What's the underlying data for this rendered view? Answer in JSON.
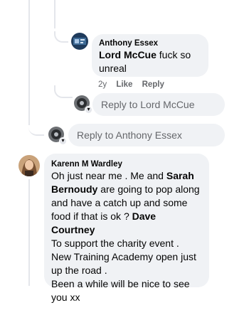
{
  "reply1": {
    "author": "Anthony Essex",
    "mention": "Lord McCue",
    "text": " fuck so unreal",
    "time": "2y",
    "like_label": "Like",
    "reply_label": "Reply"
  },
  "reply_box_inner": {
    "placeholder": "Reply to Lord McCue"
  },
  "reply_box_outer": {
    "placeholder": "Reply to Anthony Essex"
  },
  "comment2": {
    "author": "Karenn M Wardley",
    "parts": {
      "p1": "Oh just near me . Me and ",
      "m1": "Sarah Bernoudy",
      "p2": " are going to pop along and have a catch up and some food if that is ok ? ",
      "m2": "Dave Courtney",
      "line2": "To support the charity event .",
      "line3": "New Training Academy open just up the road .",
      "line4": "Been a while will be nice to see you xx"
    }
  },
  "colors": {
    "bubble": "#f0f2f5",
    "thread_line": "#e4e6eb",
    "muted_text": "#65676b"
  }
}
